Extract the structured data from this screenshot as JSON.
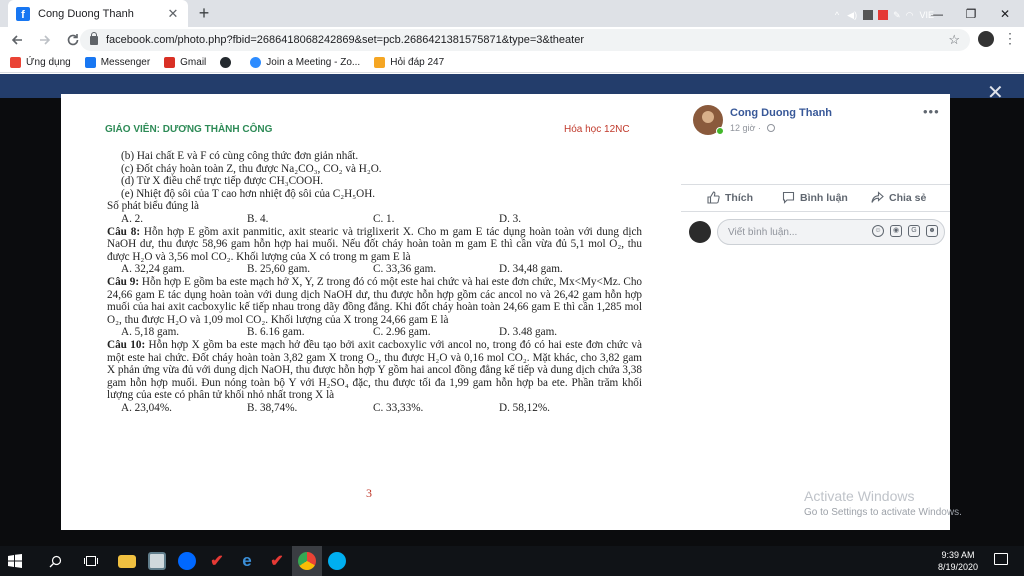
{
  "browser": {
    "tab_title": "Cong Duong Thanh",
    "tab_close": "✕",
    "new_tab": "+",
    "url": "facebook.com/photo.php?fbid=2686418068242869&set=pcb.2686421381575871&type=3&theater",
    "window_controls": {
      "minimize": "—",
      "maximize": "❐",
      "close": "✕"
    },
    "bookmarks": [
      {
        "label": "Ứng dụng",
        "icon": "apps-grid-icon",
        "color": "#ea4335"
      },
      {
        "label": "Messenger",
        "icon": "facebook-icon",
        "color": "#1877f2"
      },
      {
        "label": "Gmail",
        "icon": "gmail-icon",
        "color": "#d93025"
      },
      {
        "label": "",
        "icon": "github-icon",
        "color": "#24292e"
      },
      {
        "label": "Join a Meeting - Zo...",
        "icon": "zoom-icon",
        "color": "#2d8cff"
      },
      {
        "label": "Hỏi đáp 247",
        "icon": "hoidap-icon",
        "color": "#f5a623"
      }
    ]
  },
  "document": {
    "teacher": "GIÁO VIÊN: DƯƠNG THÀNH CÔNG",
    "subject": "Hóa học 12NC",
    "lines": [
      "(b) Hai chất E và F có cùng công thức đơn giản nhất.",
      "(c) Đốt cháy hoàn toàn Z, thu được Na₂CO₃, CO₂ và H₂O.",
      "(d) Từ X điều chế trực tiếp được CH₃COOH.",
      "(e) Nhiệt độ sôi của T cao hơn nhiệt độ sôi của C₂H₅OH.",
      "Số phát biểu đúng là"
    ],
    "q7_options": [
      "A. 2.",
      "B. 4.",
      "C. 1.",
      "D. 3."
    ],
    "q8_label": "Câu 8:",
    "q8_text": "Hỗn hợp E gồm axit panmitic, axit stearic và triglixerit X. Cho m gam E tác dụng hoàn toàn với dung dịch NaOH dư, thu được 58,96 gam hỗn hợp hai muối. Nếu đốt cháy hoàn toàn m gam E thì cần vừa đủ 5,1 mol O₂, thu được H₂O và 3,56 mol CO₂. Khối lượng của X có trong m gam E là",
    "q8_options": [
      "A. 32,24 gam.",
      "B. 25,60 gam.",
      "C. 33,36 gam.",
      "D. 34,48 gam."
    ],
    "q9_label": "Câu 9:",
    "q9_text": "Hỗn hợp E gồm ba este mạch hở X, Y, Z trong đó có một este hai chức và hai este đơn chức, Mx<My<Mz. Cho 24,66 gam E tác dụng hoàn toàn với dung dịch NaOH dư, thu được hỗn hợp gồm các ancol no và 26,42 gam hỗn hợp muối của hai axit cacboxylic kế tiếp nhau trong dãy đồng đẳng. Khi đốt cháy hoàn toàn 24,66 gam E thì cần 1,285 mol O₂, thu được H₂O và 1,09 mol CO₂. Khối lượng của X trong 24,66 gam E là",
    "q9_options": [
      "A. 5,18 gam.",
      "B. 6.16 gam.",
      "C. 2.96 gam.",
      "D. 3.48 gam."
    ],
    "q10_label": "Câu 10:",
    "q10_text": "Hỗn hợp X gồm ba este mạch hở đều tạo bởi axit cacboxylic với ancol no, trong đó có hai este đơn chức và một este hai chức. Đốt cháy hoàn toàn 3,82 gam X trong O₂, thu được H₂O và 0,16 mol CO₂. Mặt khác, cho 3,82 gam X phản ứng vừa đủ với dung dịch NaOH, thu được hỗn hợp Y gồm hai ancol đồng đẳng kế tiếp và dung dịch chứa 3,38 gam hỗn hợp muối. Đun nóng toàn bộ Y với H₂SO₄ đặc, thu được tối đa 1,99 gam hỗn hợp ba ete. Phần trăm khối lượng của este có phân tử khối nhỏ nhất trong X là",
    "q10_options": [
      "A. 23,04%.",
      "B. 38,74%.",
      "C. 33,33%.",
      "D. 58,12%."
    ],
    "page_number": "3"
  },
  "post": {
    "author": "Cong Duong Thanh",
    "time": "12 giờ",
    "more": "•••",
    "like": "Thích",
    "comment": "Bình luận",
    "share": "Chia sẻ",
    "comment_placeholder": "Viết bình luận..."
  },
  "watermark": {
    "line1": "Activate Windows",
    "line2": "Go to Settings to activate Windows."
  },
  "taskbar": {
    "time": "9:39 AM",
    "date": "8/19/2020",
    "lang": "VIE"
  },
  "colors": {
    "header_green": "#2e8b57",
    "subject_red": "#c0392b",
    "fb_blue": "#385898"
  }
}
